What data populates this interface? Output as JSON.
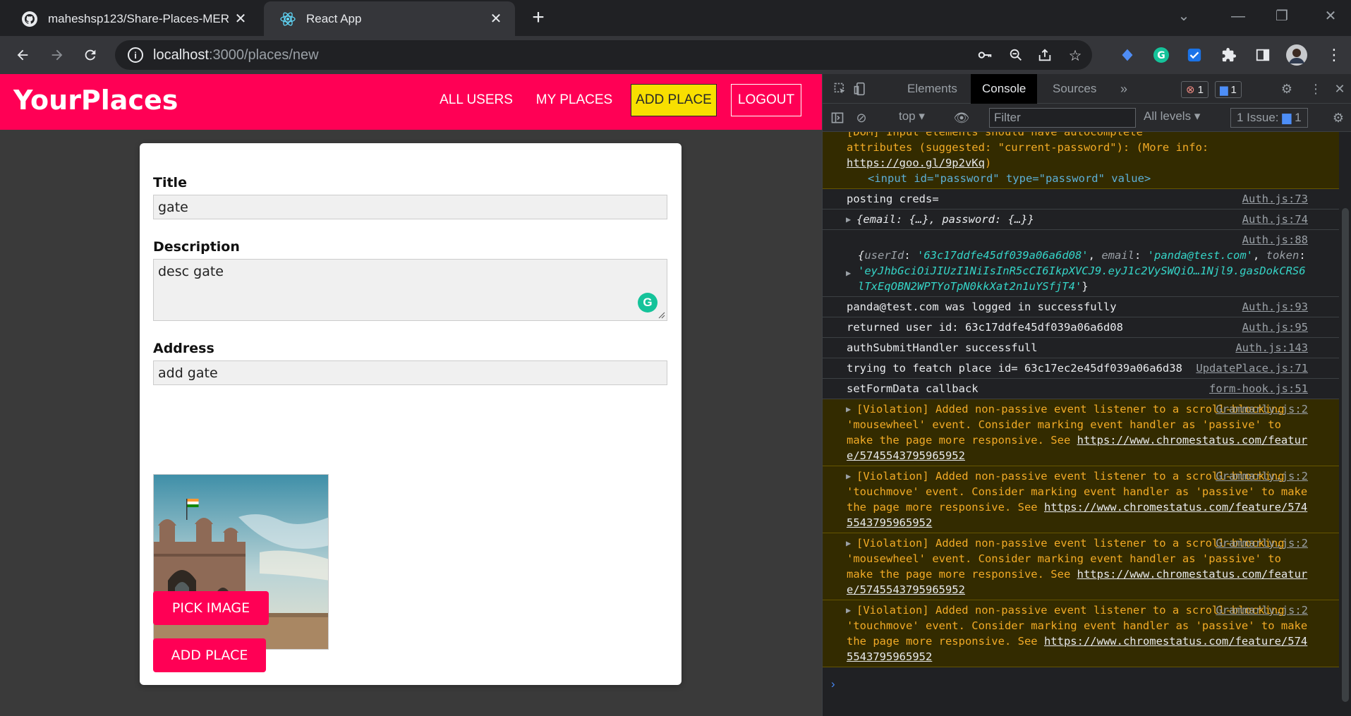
{
  "browser": {
    "tabs": [
      {
        "title": "maheshsp123/Share-Places-MER",
        "active": false
      },
      {
        "title": "React App",
        "active": true
      }
    ],
    "new_tab_label": "+",
    "url_host": "localhost",
    "url_path": ":3000/places/new"
  },
  "app": {
    "brand": "YourPlaces",
    "nav": [
      {
        "label": "ALL USERS",
        "active": false
      },
      {
        "label": "MY PLACES",
        "active": false
      },
      {
        "label": "ADD PLACE",
        "active": true
      },
      {
        "label": "LOGOUT",
        "active": false
      }
    ],
    "colors": {
      "accent": "#ff0055",
      "active_nav": "#f8df00",
      "background": "#3a3a3a"
    }
  },
  "form": {
    "title_label": "Title",
    "title_value": "gate",
    "description_label": "Description",
    "description_value": "desc gate",
    "address_label": "Address",
    "address_value": "add gate",
    "pick_image_label": "PICK IMAGE",
    "submit_label": "ADD PLACE",
    "grammarly_letter": "G"
  },
  "devtools": {
    "tabs": [
      "Elements",
      "Console",
      "Sources"
    ],
    "active_tab": "Console",
    "error_count": "1",
    "message_count": "1",
    "context": "top",
    "filter_placeholder": "Filter",
    "levels": "All levels",
    "issues_label": "1 Issue:",
    "issues_count": "1",
    "messages": [
      {
        "id": "m0",
        "text": "[DOM] Input elements should have autocomplete attributes (suggested: \"current-password\"): (More info: https://goo.gl/9p2vKq)",
        "source": "",
        "level": "warn"
      },
      {
        "id": "m1",
        "text": "posting creds=",
        "source": "Auth.js:73",
        "level": "info"
      },
      {
        "id": "m2",
        "text": "{email: {…}, password: {…}}",
        "source": "Auth.js:74",
        "level": "info"
      },
      {
        "id": "m3",
        "source": "Auth.js:88",
        "level": "info",
        "userId": "'63c17ddfe45df039a06a6d08'",
        "email": "'panda@test.com'",
        "token": "'eyJhbGciOiJIUzI1NiIsInR5cCI6IkpXVCJ9.eyJ1c2VySWQiO…1Njl9.gasDokCRS6lTxEqOBN2WPTYoTpN0kkXat2n1uYSfjT4'"
      },
      {
        "id": "m4",
        "text": "panda@test.com was logged in successfully",
        "source": "Auth.js:93",
        "level": "info"
      },
      {
        "id": "m5",
        "text": "returned user id: 63c17ddfe45df039a06a6d08",
        "source": "Auth.js:95",
        "level": "info"
      },
      {
        "id": "m6",
        "text": "authSubmitHandler successfull",
        "source": "Auth.js:143",
        "level": "info"
      },
      {
        "id": "m7",
        "text": "trying to featch place id= 63c17ec2e45df039a06a6d38",
        "source": "UpdatePlace.js:71",
        "level": "info"
      },
      {
        "id": "m8",
        "text": "setFormData callback",
        "source": "form-hook.js:51",
        "level": "info"
      },
      {
        "id": "m9",
        "text": "[Violation] Added non-passive event listener to a scroll-blocking 'mousewheel' event. Consider marking event handler as 'passive' to make the page more responsive. See",
        "link": "https://www.chromestatus.com/feature/5745543795965952",
        "source": "Grammarly.js:2",
        "level": "warn"
      },
      {
        "id": "m10",
        "text": "[Violation] Added non-passive event listener to a scroll-blocking 'touchmove' event. Consider marking event handler as 'passive' to make the page more responsive. See",
        "link": "https://www.chromestatus.com/feature/5745543795965952",
        "source": "Grammarly.js:2",
        "level": "warn"
      },
      {
        "id": "m11",
        "text": "[Violation] Added non-passive event listener to a scroll-blocking 'mousewheel' event. Consider marking event handler as 'passive' to make the page more responsive. See",
        "link": "https://www.chromestatus.com/feature/5745543795965952",
        "source": "Grammarly.js:2",
        "level": "warn"
      },
      {
        "id": "m12",
        "text": "[Violation] Added non-passive event listener to a scroll-blocking 'touchmove' event. Consider marking event handler as 'passive' to make the page more responsive. See",
        "link": "https://www.chromestatus.com/feature/5745543795965952",
        "source": "Grammarly.js:2",
        "level": "warn"
      }
    ],
    "dom_hint": {
      "prefix": "[DOM] Input elements should have autocomplete",
      "line2": "attributes (suggested: \"current-password\"): (More info: ",
      "link": "https://goo.gl/9p2vKq",
      "element": "<input id=\"password\" type=\"password\" value>"
    },
    "prompt": "›"
  }
}
